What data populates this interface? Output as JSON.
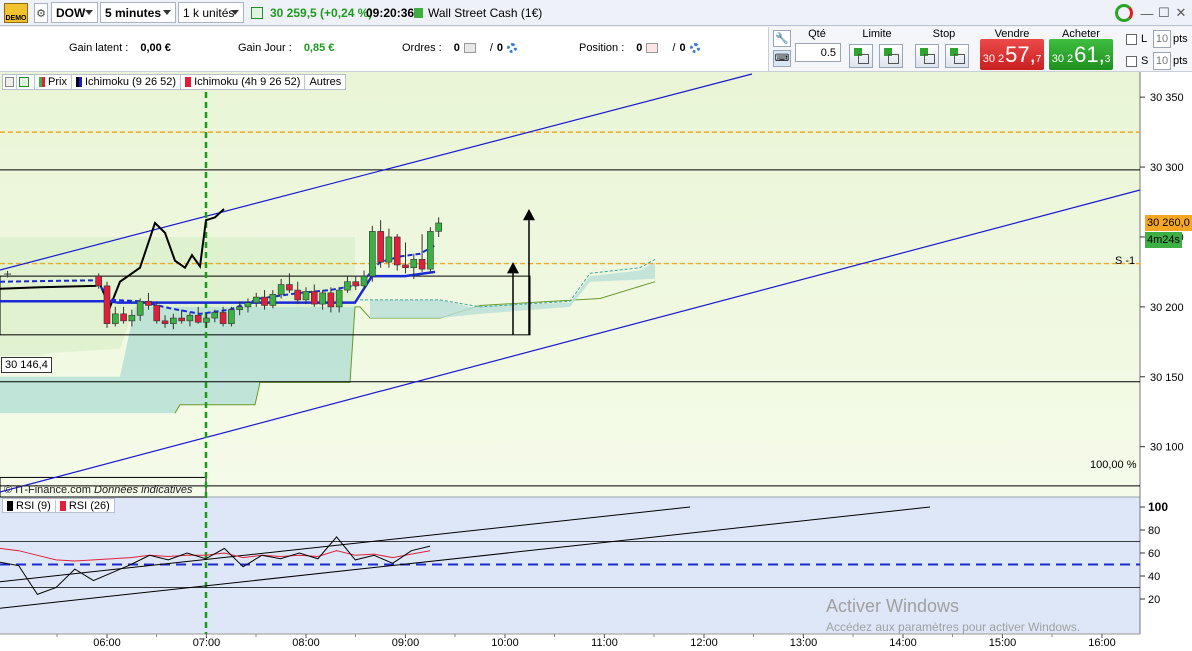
{
  "toolbar": {
    "demo_label": "DEMO",
    "instrument": "DOW",
    "timeframe": "5 minutes",
    "units": "1 k unités",
    "last_price": "30 259,5 (+0,24 %)",
    "time": "09:20:36",
    "market_name": "Wall Street Cash (1€)"
  },
  "info": {
    "gain_latent_label": "Gain latent :",
    "gain_latent_value": "0,00 €",
    "gain_jour_label": "Gain Jour :",
    "gain_jour_value": "0,85 €",
    "ordres_label": "Ordres :",
    "ordres_value": "0",
    "ordres_value2": "0",
    "position_label": "Position :",
    "position_value": "0",
    "position_value2": "0",
    "slash": "/"
  },
  "order_panel": {
    "qte_label": "Qté",
    "qte_value": "0.5",
    "limite_label": "Limite",
    "stop_label": "Stop",
    "vendre_label": "Vendre",
    "acheter_label": "Acheter",
    "sell_prefix": "30 2",
    "sell_main": "57,",
    "sell_sup": "7",
    "buy_prefix": "30 2",
    "buy_main": "61,",
    "buy_sup": "3",
    "l_label": "L",
    "s_label": "S",
    "l_pts": "10",
    "s_pts": "10",
    "pts_label": "pts"
  },
  "legend": {
    "prix": "Prix",
    "ichimoku1": "Ichimoku (9 26 52)",
    "ichimoku2": "Ichimoku (4h 9 26 52)",
    "autres": "Autres"
  },
  "rsi_legend": {
    "rsi9": "RSI (9)",
    "rsi26": "RSI (26)"
  },
  "labels": {
    "support_label": "S -1",
    "level_label": "30 146,4",
    "percent_label": "100,00 %",
    "source": "© IT-Finance.com",
    "source_note": "Données indicatives",
    "current_price_tag": "30 260,0",
    "countdown": "4m24s"
  },
  "watermark": {
    "title": "Activer Windows",
    "subtitle": "Accédez aux paramètres pour activer Windows."
  },
  "colors": {
    "bull": "#3cb043",
    "bear": "#e0203a",
    "channel": "#1a1ad0",
    "orange": "#f5a623",
    "green_vline": "#1a9c1a"
  },
  "chart_data": [
    {
      "type": "candlestick",
      "y_ticks": [
        "30 100",
        "30 150",
        "30 200",
        "30 250",
        "30 300",
        "30 350"
      ],
      "ylim": [
        30064,
        30368
      ],
      "x_ticks": [
        "06:00",
        "07:00",
        "08:00",
        "09:00",
        "10:00",
        "11:00",
        "12:00",
        "13:00",
        "14:00",
        "15:00",
        "16:00"
      ],
      "current_price": 30260.0,
      "horizontal_levels": [
        30298,
        30146.4,
        30072
      ],
      "orange_levels": [
        30325,
        30231
      ],
      "candles": [
        {
          "t": "05:55",
          "o": 30222,
          "h": 30224,
          "l": 30213,
          "c": 30215
        },
        {
          "t": "06:00",
          "o": 30215,
          "h": 30218,
          "l": 30185,
          "c": 30188
        },
        {
          "t": "06:05",
          "o": 30188,
          "h": 30200,
          "l": 30186,
          "c": 30195
        },
        {
          "t": "06:10",
          "o": 30195,
          "h": 30200,
          "l": 30188,
          "c": 30190
        },
        {
          "t": "06:15",
          "o": 30190,
          "h": 30198,
          "l": 30186,
          "c": 30194
        },
        {
          "t": "06:20",
          "o": 30194,
          "h": 30206,
          "l": 30190,
          "c": 30204
        },
        {
          "t": "06:25",
          "o": 30204,
          "h": 30210,
          "l": 30198,
          "c": 30201
        },
        {
          "t": "06:30",
          "o": 30201,
          "h": 30204,
          "l": 30188,
          "c": 30190
        },
        {
          "t": "06:35",
          "o": 30190,
          "h": 30194,
          "l": 30185,
          "c": 30188
        },
        {
          "t": "06:40",
          "o": 30188,
          "h": 30195,
          "l": 30184,
          "c": 30192
        },
        {
          "t": "06:45",
          "o": 30192,
          "h": 30198,
          "l": 30188,
          "c": 30190
        },
        {
          "t": "06:50",
          "o": 30190,
          "h": 30196,
          "l": 30186,
          "c": 30194
        },
        {
          "t": "06:55",
          "o": 30194,
          "h": 30200,
          "l": 30188,
          "c": 30189
        },
        {
          "t": "07:00",
          "o": 30189,
          "h": 30195,
          "l": 30185,
          "c": 30192
        },
        {
          "t": "07:05",
          "o": 30192,
          "h": 30198,
          "l": 30189,
          "c": 30196
        },
        {
          "t": "07:10",
          "o": 30196,
          "h": 30200,
          "l": 30186,
          "c": 30188
        },
        {
          "t": "07:15",
          "o": 30188,
          "h": 30200,
          "l": 30186,
          "c": 30198
        },
        {
          "t": "07:20",
          "o": 30198,
          "h": 30204,
          "l": 30194,
          "c": 30200
        },
        {
          "t": "07:25",
          "o": 30200,
          "h": 30206,
          "l": 30196,
          "c": 30203
        },
        {
          "t": "07:30",
          "o": 30203,
          "h": 30210,
          "l": 30200,
          "c": 30207
        },
        {
          "t": "07:35",
          "o": 30207,
          "h": 30212,
          "l": 30198,
          "c": 30201
        },
        {
          "t": "07:40",
          "o": 30201,
          "h": 30212,
          "l": 30199,
          "c": 30209
        },
        {
          "t": "07:45",
          "o": 30209,
          "h": 30220,
          "l": 30206,
          "c": 30216
        },
        {
          "t": "07:50",
          "o": 30216,
          "h": 30224,
          "l": 30210,
          "c": 30212
        },
        {
          "t": "07:55",
          "o": 30212,
          "h": 30218,
          "l": 30202,
          "c": 30205
        },
        {
          "t": "08:00",
          "o": 30205,
          "h": 30214,
          "l": 30202,
          "c": 30211
        },
        {
          "t": "08:05",
          "o": 30211,
          "h": 30216,
          "l": 30200,
          "c": 30202
        },
        {
          "t": "08:10",
          "o": 30202,
          "h": 30212,
          "l": 30198,
          "c": 30210
        },
        {
          "t": "08:15",
          "o": 30210,
          "h": 30214,
          "l": 30196,
          "c": 30200
        },
        {
          "t": "08:20",
          "o": 30200,
          "h": 30214,
          "l": 30196,
          "c": 30212
        },
        {
          "t": "08:25",
          "o": 30212,
          "h": 30222,
          "l": 30210,
          "c": 30218
        },
        {
          "t": "08:30",
          "o": 30218,
          "h": 30222,
          "l": 30212,
          "c": 30215
        },
        {
          "t": "08:35",
          "o": 30215,
          "h": 30226,
          "l": 30212,
          "c": 30222
        },
        {
          "t": "08:40",
          "o": 30222,
          "h": 30258,
          "l": 30218,
          "c": 30254
        },
        {
          "t": "08:45",
          "o": 30254,
          "h": 30262,
          "l": 30228,
          "c": 30232
        },
        {
          "t": "08:50",
          "o": 30232,
          "h": 30256,
          "l": 30228,
          "c": 30250
        },
        {
          "t": "08:55",
          "o": 30250,
          "h": 30252,
          "l": 30226,
          "c": 30230
        },
        {
          "t": "09:00",
          "o": 30230,
          "h": 30246,
          "l": 30224,
          "c": 30228
        },
        {
          "t": "09:05",
          "o": 30228,
          "h": 30238,
          "l": 30220,
          "c": 30234
        },
        {
          "t": "09:10",
          "o": 30234,
          "h": 30252,
          "l": 30225,
          "c": 30227
        },
        {
          "t": "09:15",
          "o": 30227,
          "h": 30257,
          "l": 30224,
          "c": 30254
        },
        {
          "t": "09:20",
          "o": 30254,
          "h": 30264,
          "l": 30250,
          "c": 30260
        }
      ]
    },
    {
      "type": "line",
      "title": "RSI",
      "y_ticks": [
        "20",
        "40",
        "60",
        "80",
        "100"
      ],
      "ylim": [
        0,
        100
      ],
      "levels": [
        70,
        50,
        30
      ],
      "series": [
        {
          "name": "RSI (9)",
          "values": [
            52,
            49,
            24,
            30,
            46,
            36,
            43,
            50,
            58,
            54,
            60,
            55,
            64,
            48,
            58,
            55,
            60,
            55,
            74,
            54,
            58,
            51,
            62,
            66
          ]
        },
        {
          "name": "RSI (26)",
          "values": [
            64,
            62,
            58,
            54,
            53,
            54,
            55,
            56,
            58,
            57,
            58,
            58,
            60,
            56,
            58,
            57,
            58,
            57,
            62,
            58,
            59,
            56,
            59,
            62
          ]
        }
      ]
    }
  ]
}
